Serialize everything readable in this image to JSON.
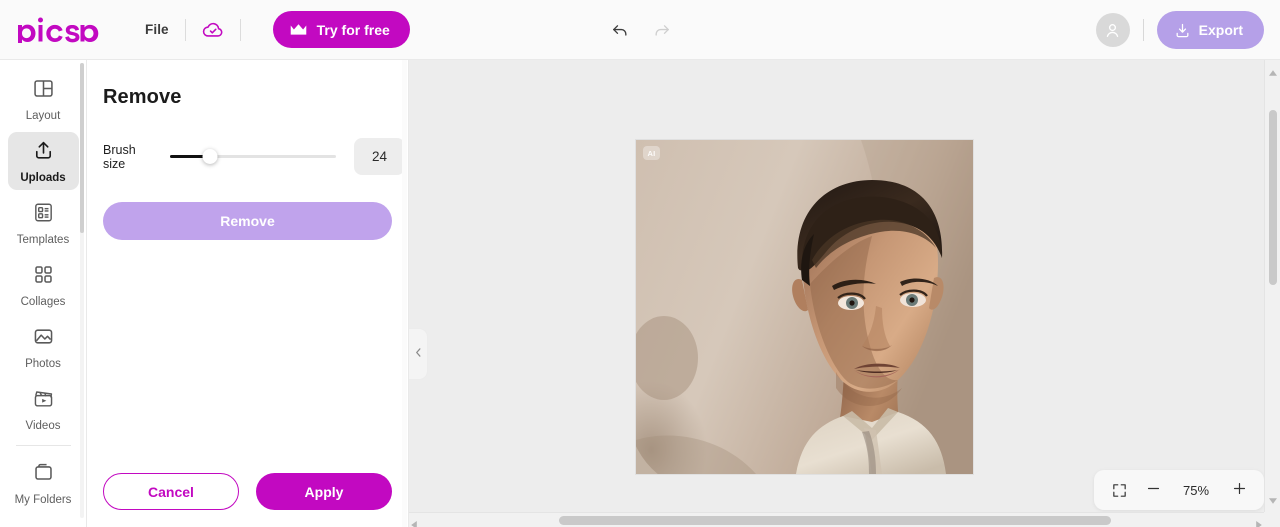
{
  "app": {
    "brand": "Picsart",
    "brand_color": "#c209c1"
  },
  "topbar": {
    "file_menu": "File",
    "cloud_icon": "cloud-check-icon",
    "try_button": {
      "label": "Try for free",
      "icon": "crown-icon"
    },
    "undo_icon": "undo-arrow-icon",
    "redo_icon": "redo-arrow-icon",
    "avatar_icon": "user-avatar-icon",
    "export_button": {
      "label": "Export",
      "icon": "download-icon"
    }
  },
  "sidebar": {
    "items": [
      {
        "label": "Layout",
        "icon": "layout-icon",
        "active": false
      },
      {
        "label": "Uploads",
        "icon": "upload-icon",
        "active": true
      },
      {
        "label": "Templates",
        "icon": "templates-icon",
        "active": false
      },
      {
        "label": "Collages",
        "icon": "collages-grid-icon",
        "active": false
      },
      {
        "label": "Photos",
        "icon": "photo-icon",
        "active": false
      },
      {
        "label": "Videos",
        "icon": "clapperboard-icon",
        "active": false
      },
      {
        "label": "My Folders",
        "icon": "folder-icon",
        "active": false
      }
    ]
  },
  "panel": {
    "title": "Remove",
    "brush_size_label": "Brush size",
    "brush_size_value": "24",
    "brush_size_percent": 24,
    "remove_button": "Remove",
    "cancel_button": "Cancel",
    "apply_button": "Apply",
    "collapse_icon": "chevron-left-icon"
  },
  "canvas": {
    "ai_badge": "AI",
    "image_description": "portrait-photo-man"
  },
  "zoom": {
    "fit_icon": "fit-to-screen-icon",
    "minus_icon": "minus-icon",
    "value": "75%",
    "plus_icon": "plus-icon"
  }
}
